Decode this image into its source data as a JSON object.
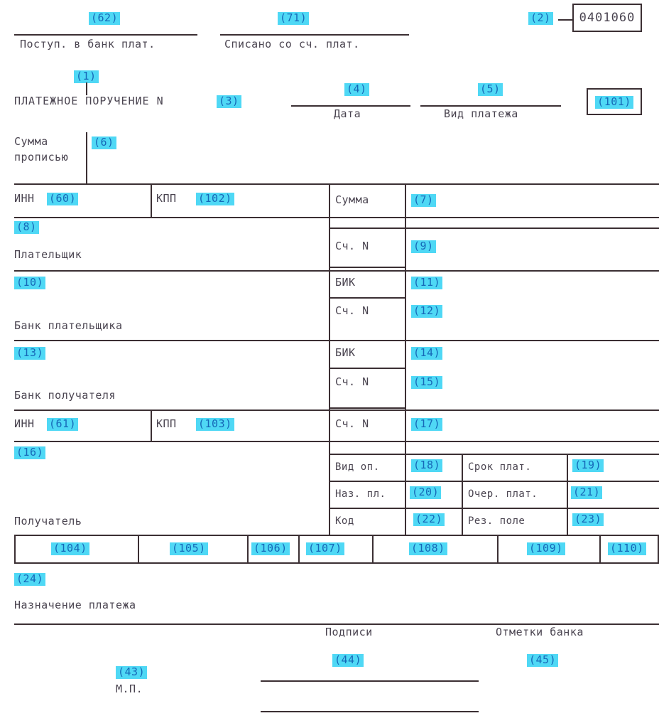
{
  "form": {
    "code_box_value": "0401060",
    "title": "ПЛАТЕЖНОЕ ПОРУЧЕНИЕ N",
    "field_101_value": "(101)"
  },
  "header": {
    "tag_62": "(62)",
    "tag_71": "(71)",
    "tag_2": "(2)",
    "label_postup": "Поступ. в банк плат.",
    "label_spisano": "Списано со сч. плат.",
    "tag_1": "(1)",
    "tag_3": "(3)",
    "tag_4": "(4)",
    "tag_5": "(5)",
    "label_data": "Дата",
    "label_vid_platezha": "Вид платежа"
  },
  "amount_words": {
    "label_line1": "Сумма",
    "label_line2": "прописью",
    "tag_6": "(6)"
  },
  "payer": {
    "inn_label": "ИНН",
    "tag_60": "(60)",
    "kpp_label": "КПП",
    "tag_102": "(102)",
    "tag_8": "(8)",
    "label": "Плательщик"
  },
  "payer_bank": {
    "tag_10": "(10)",
    "label": "Банк плательщика"
  },
  "payee_bank": {
    "tag_13": "(13)",
    "label": "Банк получателя"
  },
  "payee": {
    "inn_label": "ИНН",
    "tag_61": "(61)",
    "kpp_label": "КПП",
    "tag_103": "(103)",
    "tag_16": "(16)",
    "label": "Получатель"
  },
  "right_column": {
    "rows": [
      {
        "label": "Сумма",
        "tag": "(7)"
      },
      {
        "label": "Сч. N",
        "tag": "(9)"
      },
      {
        "label": "БИК",
        "tag": "(11)"
      },
      {
        "label": "Сч. N",
        "tag": "(12)"
      },
      {
        "label": "БИК",
        "tag": "(14)"
      },
      {
        "label": "Сч. N",
        "tag": "(15)"
      },
      {
        "label": "Сч. N",
        "tag": "(17)"
      }
    ]
  },
  "detail_grid": {
    "rows": [
      {
        "left_label": "Вид оп.",
        "left_tag": "(18)",
        "right_label": "Срок плат.",
        "right_tag": "(19)"
      },
      {
        "left_label": "Наз. пл.",
        "left_tag": "(20)",
        "right_label": "Очер. плат.",
        "right_tag": "(21)"
      },
      {
        "left_label": "Код",
        "left_tag": "(22)",
        "right_label": "Рез. поле",
        "right_tag": "(23)"
      }
    ]
  },
  "budget_row": {
    "cells": [
      "(104)",
      "(105)",
      "(106)",
      "(107)",
      "(108)",
      "(109)",
      "(110)"
    ]
  },
  "purpose": {
    "tag_24": "(24)",
    "label": "Назначение платежа"
  },
  "footer": {
    "label_podpisi": "Подписи",
    "label_otmetki": "Отметки банка",
    "tag_43": "(43)",
    "label_mp": "М.П.",
    "tag_44": "(44)",
    "tag_45": "(45)"
  },
  "colors": {
    "highlight": "#4fd8f5",
    "highlight_text": "#1668b8",
    "rule": "#3b2f33",
    "label_text": "#4a4450"
  }
}
